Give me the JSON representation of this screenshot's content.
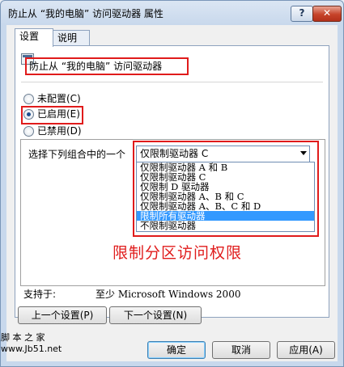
{
  "window": {
    "title": "防止从 “我的电脑” 访问驱动器 属性",
    "help_glyph": "?",
    "close_glyph": "✕"
  },
  "tabs": [
    {
      "label": "设置",
      "active": true
    },
    {
      "label": "说明",
      "active": false
    }
  ],
  "policy": {
    "icon": "policy-document-icon",
    "name": "防止从 “我的电脑” 访问驱动器"
  },
  "state": {
    "options": [
      {
        "label": "未配置(C)",
        "selected": false
      },
      {
        "label": "已启用(E)",
        "selected": true
      },
      {
        "label": "已禁用(D)",
        "selected": false
      }
    ]
  },
  "options_panel": {
    "prompt": "选择下列组合中的一个",
    "dropdown_value": "仅限制驱动器 C",
    "dropdown_items": [
      {
        "label": "仅限制驱动器 A 和 B",
        "highlighted": false
      },
      {
        "label": "仅限制驱动器 C",
        "highlighted": false
      },
      {
        "label": "仅限制 D 驱动器",
        "highlighted": false
      },
      {
        "label": "仅限制驱动器 A、B 和 C",
        "highlighted": false
      },
      {
        "label": "仅限制驱动器 A、B、C 和 D",
        "highlighted": false
      },
      {
        "label": "限制所有驱动器",
        "highlighted": true
      },
      {
        "label": "不限制驱动器",
        "highlighted": false
      }
    ],
    "annotation": "限制分区访问权限"
  },
  "support": {
    "label": "支持于:",
    "value": "至少 Microsoft Windows 2000"
  },
  "nav_buttons": {
    "prev": "上一个设置(P)",
    "next": "下一个设置(N)"
  },
  "dialog_buttons": {
    "ok": "确定",
    "cancel": "取消",
    "apply": "应用(A)"
  },
  "watermark": {
    "line1": "脚 本 之 家",
    "line2": "www.Jb51.net"
  },
  "colors": {
    "highlight_red": "#e01b1b",
    "selection_blue": "#3399ff"
  }
}
